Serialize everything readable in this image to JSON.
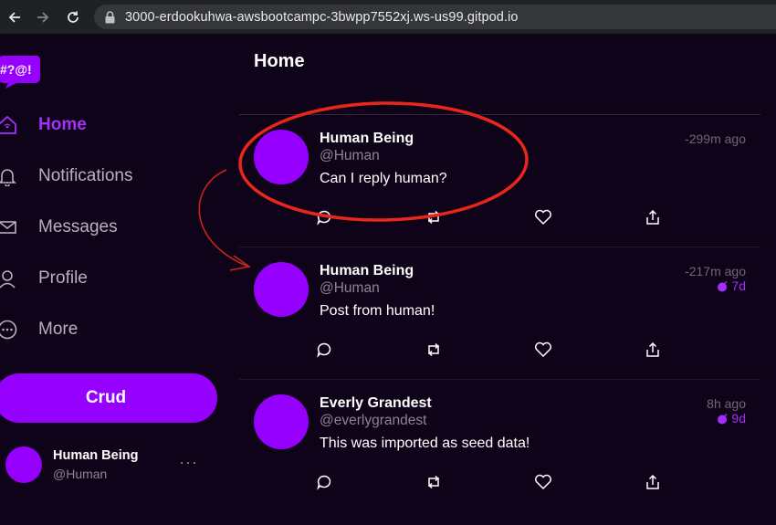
{
  "browser": {
    "url": "3000-erdookuhwa-awsbootcampc-3bwpp7552xj.ws-us99.gitpod.io"
  },
  "logo": {
    "text": "#?@!"
  },
  "sidebar": {
    "items": [
      {
        "label": "Home",
        "icon": "home-icon",
        "active": true
      },
      {
        "label": "Notifications",
        "icon": "bell-icon",
        "active": false
      },
      {
        "label": "Messages",
        "icon": "envelope-icon",
        "active": false
      },
      {
        "label": "Profile",
        "icon": "user-icon",
        "active": false
      },
      {
        "label": "More",
        "icon": "more-circle-icon",
        "active": false
      }
    ],
    "crud_label": "Crud",
    "profile": {
      "name": "Human Being",
      "handle": "@Human",
      "more": "···"
    }
  },
  "main": {
    "title": "Home",
    "activities": [
      {
        "name": "Human Being",
        "handle": "@Human",
        "message": "Can I reply human?",
        "time": "-299m ago",
        "expires": ""
      },
      {
        "name": "Human Being",
        "handle": "@Human",
        "message": "Post from human!",
        "time": "-217m ago",
        "expires": "7d"
      },
      {
        "name": "Everly Grandest",
        "handle": "@everlygrandest",
        "message": "This was imported as seed data!",
        "time": "8h ago",
        "expires": "9d"
      }
    ]
  },
  "colors": {
    "background": "#0f0319",
    "accent": "#9500ff",
    "accent_text": "#a130f9",
    "annotation": "#e8261a"
  }
}
